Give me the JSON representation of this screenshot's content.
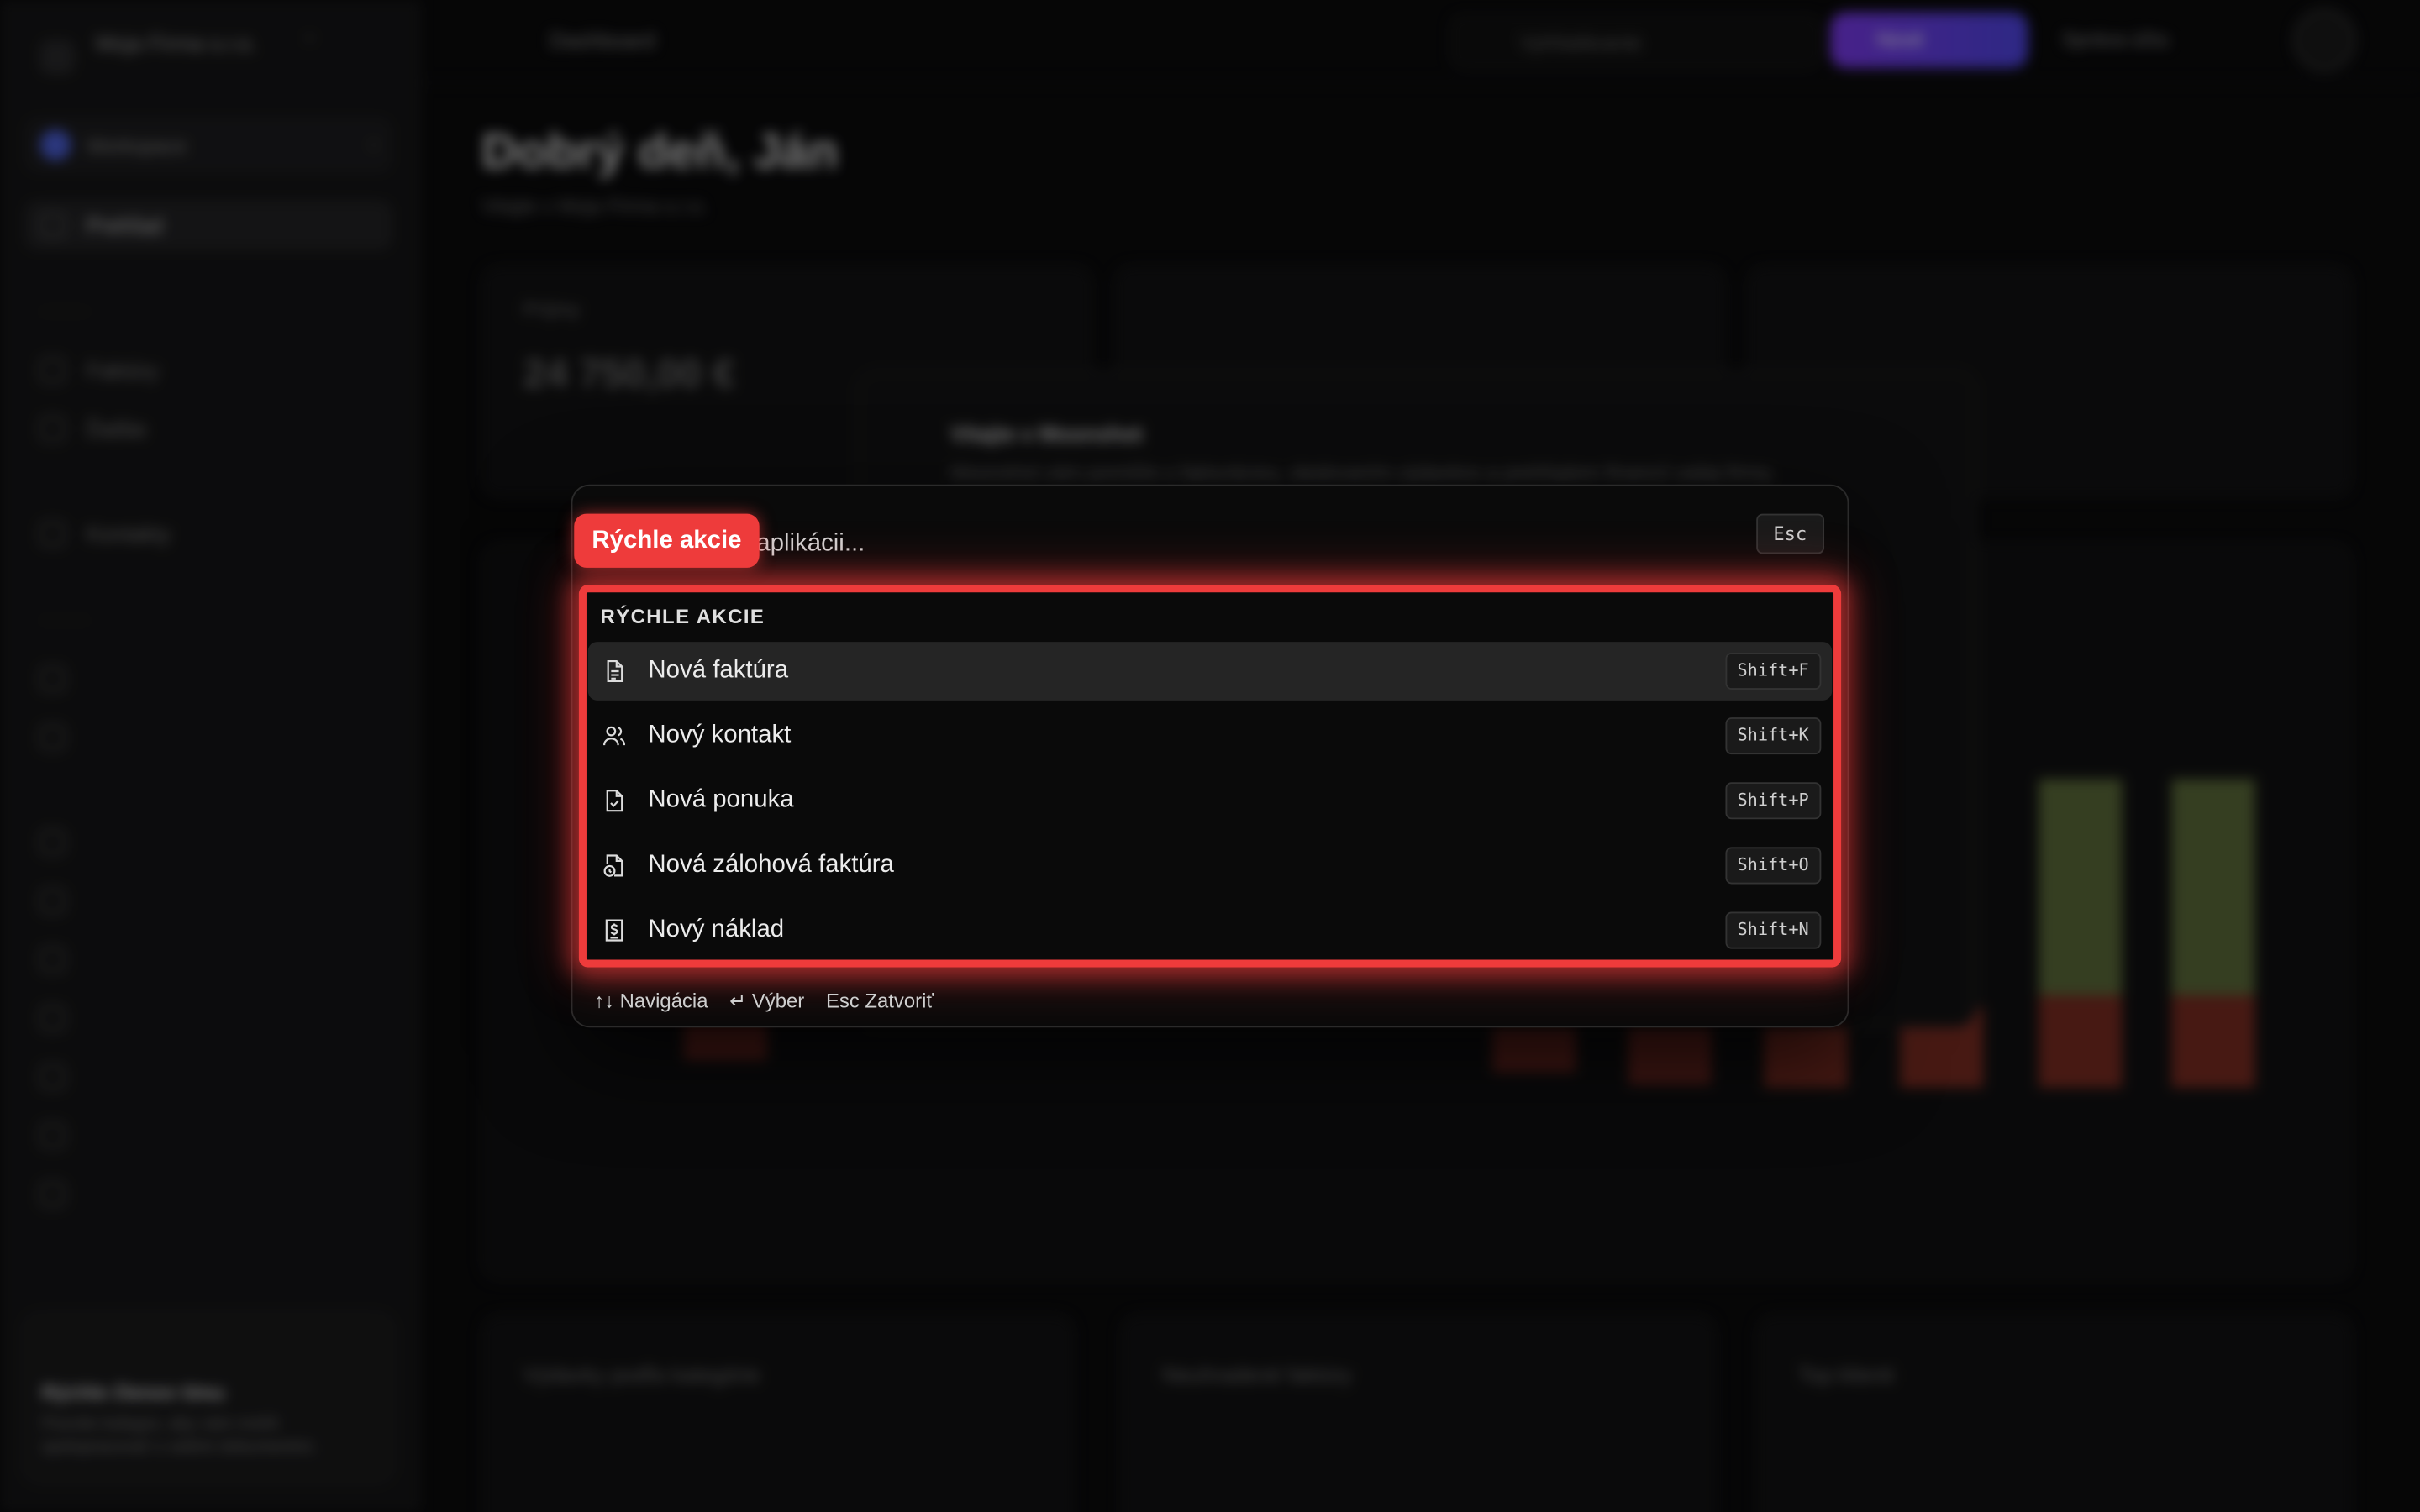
{
  "background": {
    "org_name": "Moja Firma s.r.o.",
    "workspace_switch": "Workspace",
    "nav_overview": "Prehľad",
    "nav_invoices": "Faktúry",
    "nav_more": "Ďalšie",
    "nav_contacts": "Kontakty",
    "breadcrumb": "Dashboard",
    "search_placeholder": "Vyhľadávanie",
    "new_button": "Nové",
    "top_link": "Správa účtu",
    "greeting": "Dobrý deň, Ján",
    "greeting_sub": "Vitajte v Moja Firma s.r.o.",
    "card1_title": "Príjmy",
    "card1_value": "24 750,00 €",
    "welcome_title": "Vitajte v Moonshot",
    "welcome_sub": "Moonshot vám pomôže s fakturáciou, sledovaním výdavkov a prehľadom financií vašej firmy.",
    "promo_title": "Rýchle členov tímu",
    "promo_sub": "Pozvite kolegov, aby vám mohli spolupracovať s vašimi dokumentmi.",
    "bottom1_title": "Výdavky podľa kategórie",
    "bottom2_title": "Neuhradené faktúry",
    "bottom3_title": "Top klienti"
  },
  "palette": {
    "search_placeholder": "Hľadať v celej aplikácii...",
    "esc_key": "Esc",
    "annotation_label": "Rýchle akcie",
    "group_title": "RÝCHLE AKCIE",
    "items": [
      {
        "label": "Nová faktúra",
        "shortcut": "Shift+F",
        "icon": "document-icon"
      },
      {
        "label": "Nový kontakt",
        "shortcut": "Shift+K",
        "icon": "users-icon"
      },
      {
        "label": "Nová ponuka",
        "shortcut": "Shift+P",
        "icon": "document-check-icon"
      },
      {
        "label": "Nová zálohová faktúra",
        "shortcut": "Shift+O",
        "icon": "document-clock-icon"
      },
      {
        "label": "Nový náklad",
        "shortcut": "Shift+N",
        "icon": "receipt-dollar-icon"
      }
    ],
    "footer": {
      "navigate": "↑↓ Navigácia",
      "select": "↵ Výber",
      "close": "Esc Zatvoriť"
    },
    "accent_color": "#ee3b3b"
  }
}
